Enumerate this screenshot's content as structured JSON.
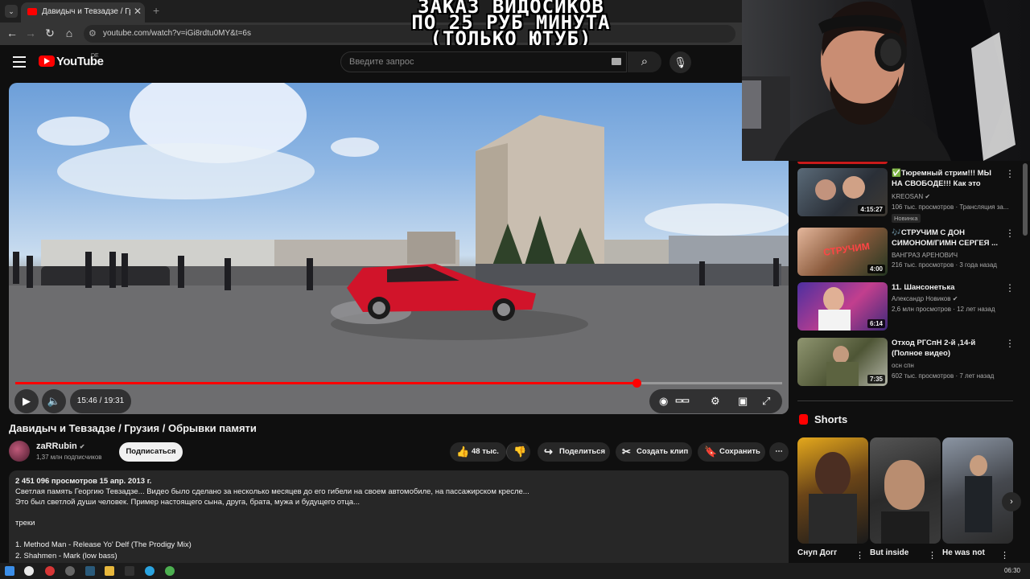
{
  "browser": {
    "tab_title": "Давидыч и Тевзадзе / Грузия /...",
    "url": "youtube.com/watch?v=iGi8rdtu0MY&t=6s"
  },
  "overlay": {
    "line1": "ЗАКАЗ ВИДОСИКОВ",
    "line2": "ПО 25 РУБ МИНУТА",
    "line3": "(ТОЛЬКО ЮТУБ)"
  },
  "header": {
    "brand": "YouTube",
    "country": "DE",
    "search_placeholder": "Введите запрос"
  },
  "player": {
    "time": "15:46 / 19:31",
    "progress": 0.81,
    "colors": {
      "progress": "#ff0000"
    }
  },
  "video": {
    "title": "Давидыч и Тевзадзе / Грузия / Обрывки памяти",
    "channel": "zaRRubin",
    "subscribers": "1,37 млн подписчиков",
    "subscribe_label": "Подписаться",
    "likes": "48 тыс.",
    "share_label": "Поделиться",
    "clip_label": "Создать клип",
    "save_label": "Сохранить"
  },
  "description": {
    "stats": "2 451 096 просмотров  15 апр. 2013 г.",
    "line1": "Светлая память Георгию Тевзадзе... Видео было сделано за несколько месяцев до его гибели на своем автомобиле, на пассажирском кресле...",
    "line2": "Это был светлой души человек. Пример настоящего сына, друга, брата, мужа и будущего отца...",
    "line3": "треки",
    "line4": "1. Method Man - Release Yo' Delf (The Prodigy Mix)",
    "line5": "2. Shahmen - Mark (low bass)"
  },
  "recommendations": [
    {
      "title": "✅Тюремный стрим!!! МЫ НА СВОБОДЕ!!! Как это было НА...",
      "channel": "KREOSAN",
      "meta": "106 тыс. просмотров · Трансляция за...",
      "duration": "4:15:27",
      "badge": "Новинка"
    },
    {
      "title": "🎶СТРУЧИМ С ДОН СИМОНОМ/ГИМН СЕРГЕЯ ...",
      "channel": "ВАНГРАЗ АРЕНОВИЧ",
      "meta": "216 тыс. просмотров · 3 года назад",
      "duration": "4:00"
    },
    {
      "title": "11. Шансонетька",
      "channel": "Александр Новиков",
      "meta": "2,6 млн просмотров · 12 лет назад",
      "duration": "6:14"
    },
    {
      "title": "Отход РГСпН  2-й ,14-й (Полное видео)",
      "channel": "осн спн",
      "meta": "602 тыс. просмотров · 7 лет назад",
      "duration": "7:35"
    }
  ],
  "shorts": {
    "heading": "Shorts",
    "items": [
      {
        "title": "Снуп Догг"
      },
      {
        "title": "But inside"
      },
      {
        "title": "He was not"
      }
    ]
  },
  "taskbar": {
    "clock": "06:30"
  }
}
